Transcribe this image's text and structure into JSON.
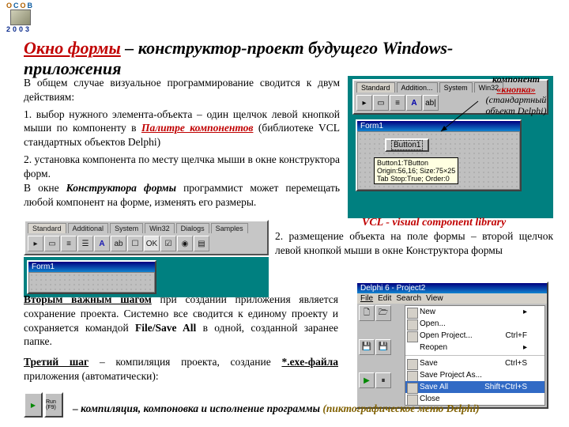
{
  "logoYear": "2003",
  "title": {
    "a": "Окно формы",
    "b": " – конструктор-проект будущего Windows-приложения"
  },
  "p1": "В общем случае визуальное программирование сводится к двум действиям:",
  "p2a": "1. выбор нужного элемента-объекта – один щелчок левой кнопкой мыши по компоненту в ",
  "p2b": "Палитре компонентов",
  "p2c": " (библиотеке VCL стандартных объектов Delphi)",
  "p3": "2. установка компонента по месту щелчка мыши в окне конструктора форм.",
  "p4a": "В окне ",
  "p4b": "Конструктора формы",
  "p4c": " программист может перемещать любой компонент на форме, изменять его размеры.",
  "vcl": "VCL - visual component library",
  "p5": "2. размещение объекта на поле формы – второй щелчок левой кнопкой мыши в окне Конструктора формы",
  "p6a": "Вторым важным шагом",
  "p6b": " при создании приложения является сохранение проекта. Системно все сводится к единому проекту и сохраняется командой ",
  "p6c": "File/Save All",
  "p6d": " в одной, созданной заранее папке.",
  "p7a": "Третий шаг",
  "p7b": " – компиляция проекта, создание ",
  "p7c": "*.exe-файла",
  "p7d": " приложения (автоматически):",
  "footer": {
    "a": "– компиляция, компоновка и исполнение программы ",
    "b": "(пиктографическое меню Delphi)"
  },
  "callout": {
    "a": "компонент",
    "b": "«кнопка»",
    "c": "(стандартный",
    "d": "объект Delphi)"
  },
  "paletteTabs": [
    "Standard",
    "Addition...",
    "System",
    "Win32"
  ],
  "paletteTabs2": [
    "Standard",
    "Additional",
    "System",
    "Win32",
    "Dialogs",
    "Samples"
  ],
  "form1": "Form1",
  "button1": "Button1",
  "tip": "Button1:TButton\nOrigin:56,16; Size:75×25\nTab Stop:True; Order:0",
  "delphiTitle": "Delphi 6 - Project2",
  "menubar": [
    "File",
    "Edit",
    "Search",
    "View"
  ],
  "fileMenu": [
    {
      "l": "New",
      "sc": "",
      "ic": true,
      "arrow": true
    },
    {
      "l": "Open...",
      "sc": "",
      "ic": true
    },
    {
      "l": "Open Project...",
      "sc": "Ctrl+F",
      "ic": true
    },
    {
      "l": "Reopen",
      "sc": "",
      "arrow": true
    },
    {
      "sep": true
    },
    {
      "l": "Save",
      "sc": "Ctrl+S",
      "ic": true
    },
    {
      "l": "Save Project As...",
      "sc": "",
      "ic": true
    },
    {
      "l": "Save All",
      "sc": "Shift+Ctrl+S",
      "ic": true,
      "hl": true
    },
    {
      "l": "Close",
      "sc": "",
      "ic": true
    }
  ],
  "runLabel": "Run (F9)"
}
